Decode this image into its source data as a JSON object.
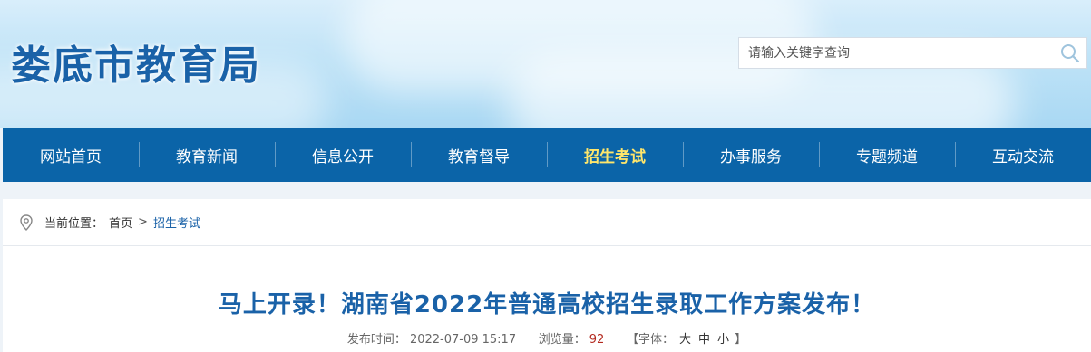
{
  "header": {
    "site_title": "娄底市教育局",
    "search_placeholder": "请输入关键字查询"
  },
  "nav": {
    "items": [
      "网站首页",
      "教育新闻",
      "信息公开",
      "教育督导",
      "招生考试",
      "办事服务",
      "专题频道",
      "互动交流"
    ],
    "active_index": 4
  },
  "breadcrumb": {
    "prefix": "当前位置：",
    "items": [
      "首页",
      "招生考试"
    ],
    "separator": ">"
  },
  "article": {
    "title": "马上开录！湖南省2022年普通高校招生录取工作方案发布！",
    "publish_label": "发布时间：",
    "publish_time": "2022-07-09 15:17",
    "views_label": "浏览量：",
    "views": "92",
    "font_open": "【字体：",
    "font_large": "大",
    "font_medium": "中",
    "font_small": "小",
    "font_close": "】"
  },
  "colors": {
    "nav_bg": "#0b64a8",
    "nav_active": "#ffe66b",
    "title_blue": "#1a62a8",
    "views_red": "#b3281e"
  },
  "icons": {
    "search": "search-icon",
    "location": "location-pin-icon"
  }
}
